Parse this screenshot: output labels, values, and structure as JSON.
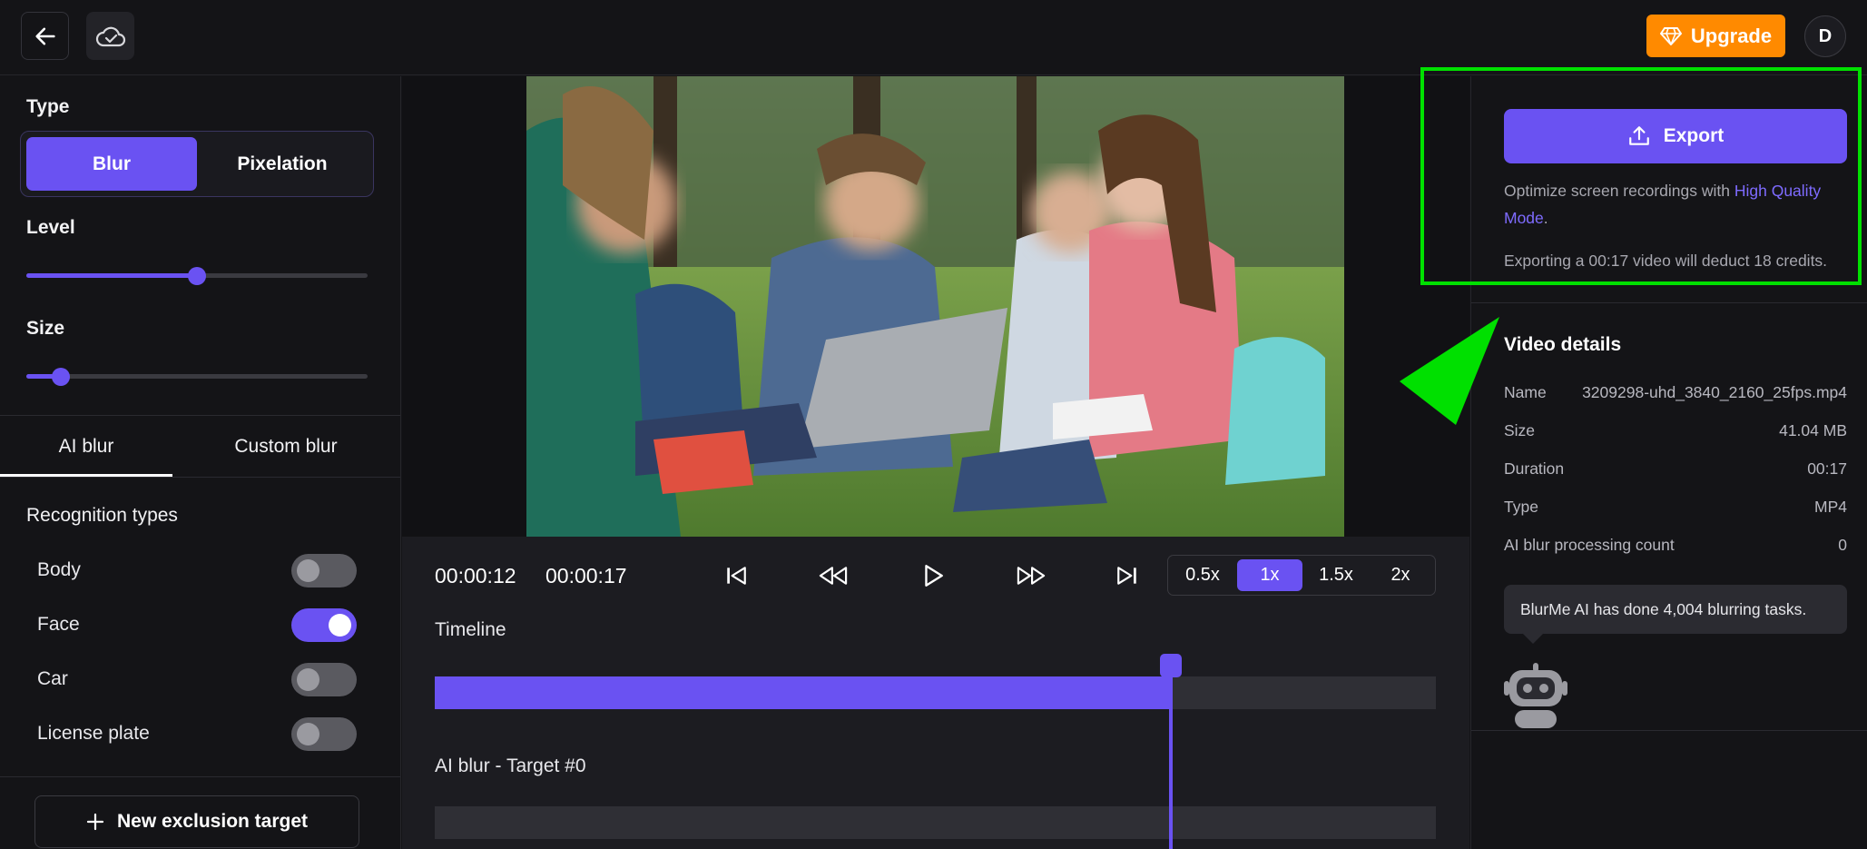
{
  "header": {
    "upgrade_label": "Upgrade",
    "avatar_initial": "D"
  },
  "left": {
    "type_label": "Type",
    "type_options": [
      "Blur",
      "Pixelation"
    ],
    "level_label": "Level",
    "level_value": 0.5,
    "size_label": "Size",
    "size_value": 0.1,
    "tabs": [
      "AI blur",
      "Custom blur"
    ],
    "recognition_label": "Recognition types",
    "toggles": [
      {
        "label": "Body",
        "on": false
      },
      {
        "label": "Face",
        "on": true
      },
      {
        "label": "Car",
        "on": false
      },
      {
        "label": "License plate",
        "on": false
      }
    ],
    "exclusion_label": "New exclusion target"
  },
  "player": {
    "current_time": "00:00:12",
    "total_time": "00:00:17",
    "speeds": [
      "0.5x",
      "1x",
      "1.5x",
      "2x"
    ],
    "active_speed": "1x",
    "timeline_label": "Timeline",
    "progress": 0.735,
    "track_label": "AI blur - Target #0"
  },
  "right": {
    "export_label": "Export",
    "optimize_prefix": "Optimize screen recordings with ",
    "optimize_link": "High Quality Mode",
    "optimize_suffix": ".",
    "credits_note": "Exporting a 00:17 video will deduct 18 credits.",
    "details_title": "Video details",
    "details": [
      {
        "key": "Name",
        "value": "3209298-uhd_3840_2160_25fps.mp4"
      },
      {
        "key": "Size",
        "value": "41.04 MB"
      },
      {
        "key": "Duration",
        "value": "00:17"
      },
      {
        "key": "Type",
        "value": "MP4"
      },
      {
        "key": "AI blur processing count",
        "value": "0"
      }
    ],
    "tooltip": "BlurMe AI has done 4,004 blurring tasks."
  },
  "colors": {
    "accent": "#6a52f2",
    "upgrade": "#ff8a00",
    "highlight": "#00e000"
  }
}
